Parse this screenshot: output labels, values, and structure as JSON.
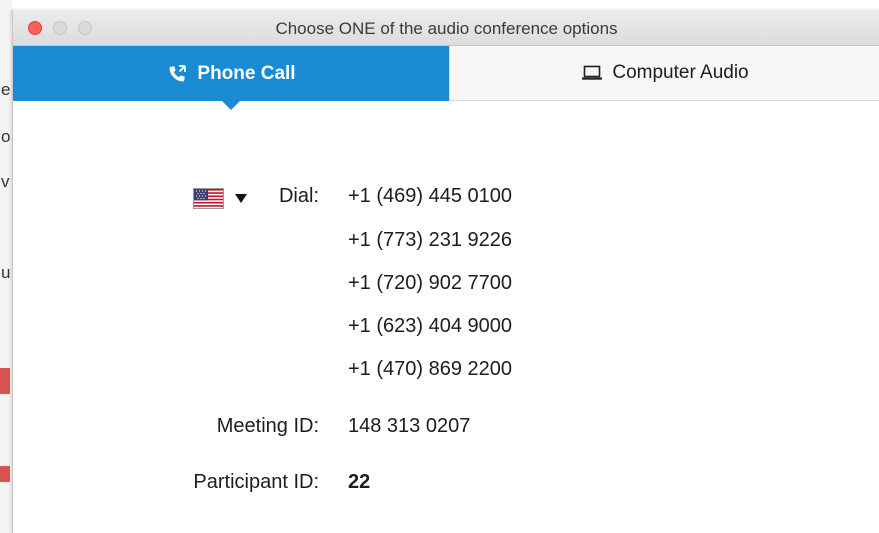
{
  "window": {
    "title": "Choose ONE of the audio conference options"
  },
  "tabs": [
    {
      "label": "Phone Call",
      "icon": "phone-icon",
      "active": true
    },
    {
      "label": "Computer Audio",
      "icon": "laptop-icon",
      "active": false
    }
  ],
  "dial": {
    "country_icon": "us-flag-icon",
    "label": "Dial:",
    "numbers": [
      "+1 (469) 445 0100",
      "+1 (773) 231 9226",
      "+1 (720) 902 7700",
      "+1 (623) 404 9000",
      "+1 (470) 869 2200"
    ]
  },
  "meeting": {
    "id_label": "Meeting ID:",
    "id_value": "148 313 0207",
    "participant_label": "Participant ID:",
    "participant_value": "22"
  },
  "background": {
    "chars": [
      "e",
      "o",
      "v",
      "u"
    ]
  },
  "colors": {
    "accent": "#1a8ad4",
    "close": "#fe5f57"
  }
}
